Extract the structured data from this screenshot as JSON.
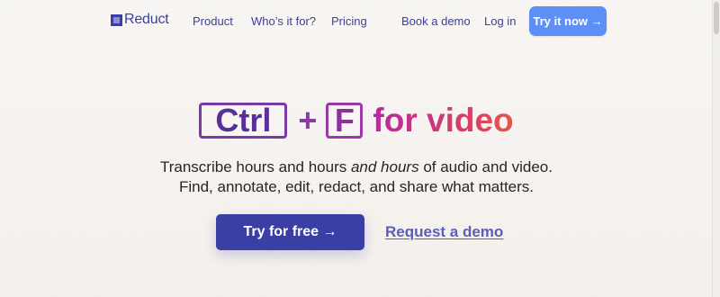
{
  "brand": {
    "name": "Reduct"
  },
  "nav": {
    "links": [
      "Product",
      "Who’s it for?",
      "Pricing",
      "Book a demo",
      "Log in"
    ],
    "cta": "Try it now →"
  },
  "hero": {
    "key1": "Ctrl",
    "plus": "+",
    "key2": "F",
    "headline_rest": "for video",
    "subtitle_line1_a": "Transcribe hours and hours ",
    "subtitle_line1_em": "and hours",
    "subtitle_line1_b": " of audio and video.",
    "subtitle_line2": "Find, annotate, edit, redact, and share what matters.",
    "primary_button": "Try for free →",
    "secondary_link": "Request a demo"
  },
  "colors": {
    "brand": "#3b3fa4",
    "cta_blue": "#5e8ff5",
    "gradient_start": "#b52aa0",
    "gradient_end": "#e4584a"
  }
}
